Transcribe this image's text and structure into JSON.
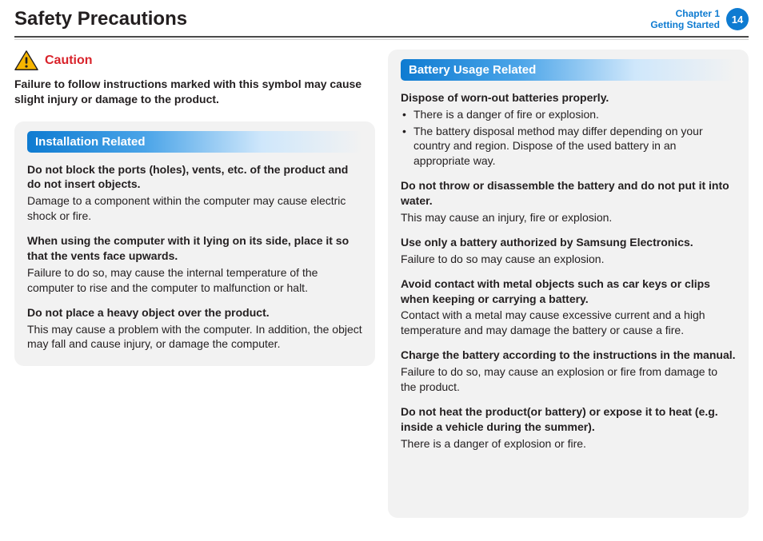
{
  "header": {
    "title": "Safety Precautions",
    "chapter_line1": "Chapter 1",
    "chapter_line2": "Getting Started",
    "page_number": "14"
  },
  "caution": {
    "label": "Caution",
    "description": "Failure to follow instructions marked with this symbol may cause slight injury or damage to the product."
  },
  "left": {
    "section_title": "Installation Related",
    "items": [
      {
        "heading": "Do not block the ports (holes), vents, etc. of the product and do not insert objects.",
        "body": "Damage to a component within the computer may cause electric shock or fire."
      },
      {
        "heading": "When using the computer with it lying on its side, place it so that the vents face upwards.",
        "body": "Failure to do so, may cause the internal temperature of the computer to rise and the computer to malfunction or halt."
      },
      {
        "heading": "Do not place a heavy object over the product.",
        "body": "This may cause a problem with the computer. In addition, the object may fall and cause injury, or damage the computer."
      }
    ]
  },
  "right": {
    "section_title": "Battery Usage Related",
    "block1_heading": "Dispose of worn-out batteries properly.",
    "block1_bullets": [
      "There is a danger of fire or explosion.",
      "The battery disposal method may differ depending on your country and region. Dispose of the used battery in an appropriate way."
    ],
    "items": [
      {
        "heading": "Do not throw or disassemble the battery and do not put it into water.",
        "body": "This may cause an injury, fire or explosion."
      },
      {
        "heading": "Use only a battery authorized by Samsung Electronics.",
        "body": "Failure to do so may cause an explosion."
      },
      {
        "heading": "Avoid contact with metal objects such as car keys or clips when keeping or carrying a battery.",
        "body": "Contact with a metal may cause excessive current and a high temperature and may damage the battery or cause a fire."
      },
      {
        "heading": "Charge the battery according to the instructions in the manual.",
        "body": "Failure to do so, may cause an explosion or fire from damage to the product."
      },
      {
        "heading": "Do not heat the product(or battery) or expose it to heat (e.g. inside a vehicle during the summer).",
        "body": "There is a danger of explosion or fire."
      }
    ]
  }
}
